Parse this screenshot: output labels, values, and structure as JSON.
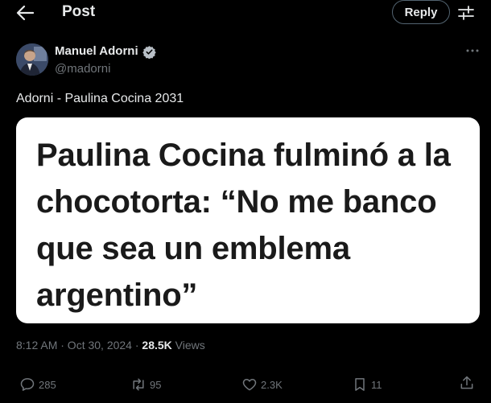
{
  "header": {
    "title": "Post",
    "reply_label": "Reply",
    "back_icon": "arrow-left-icon",
    "filter_icon": "sliders-icon"
  },
  "author": {
    "name": "Manuel Adorni",
    "handle": "@madorni",
    "verified": true,
    "verified_color": "#1d9bf0"
  },
  "post": {
    "text": "Adorni - Paulina Cocina 2031",
    "image_headline": "Paulina Cocina fulminó a la chocotorta: “No me banco que sea un emblema argentino”",
    "timestamp": "8:12 AM · Oct 30, 2024 · ",
    "views_count": "28.5K",
    "views_label": " Views"
  },
  "actions": {
    "replies": "285",
    "reposts": "95",
    "likes": "2.3K",
    "bookmarks": "11"
  },
  "colors": {
    "background": "#000000",
    "text_primary": "#e7e9ea",
    "text_secondary": "#71767b",
    "border": "#536471"
  }
}
